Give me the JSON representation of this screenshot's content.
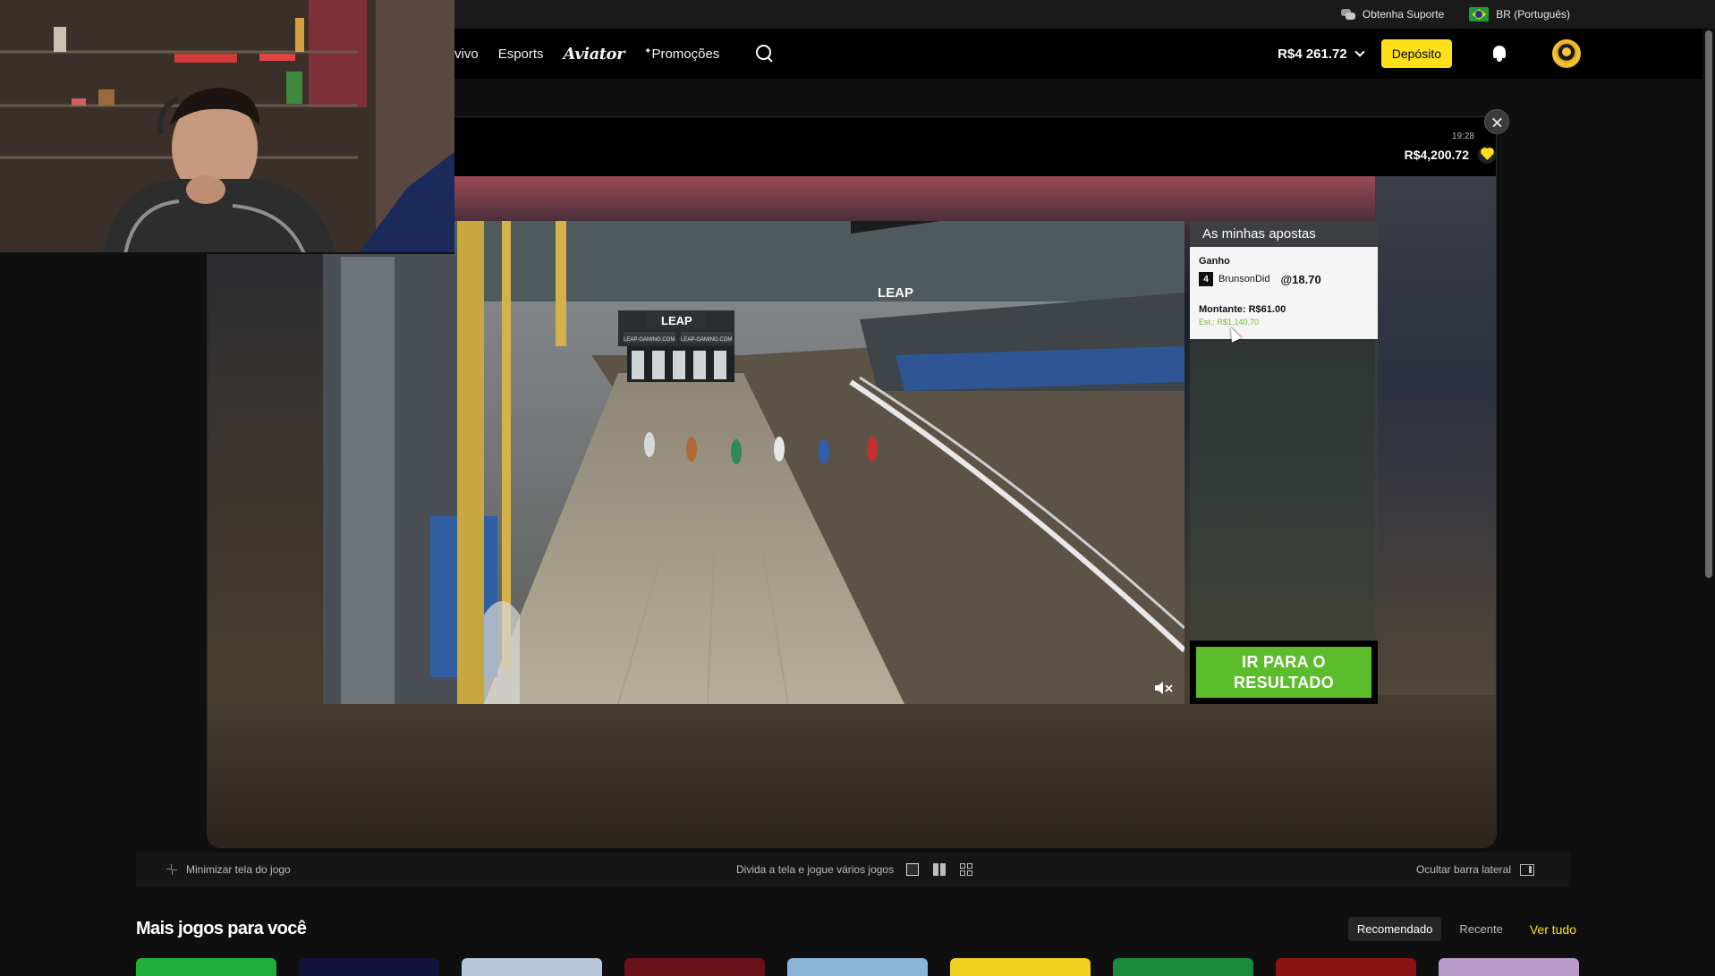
{
  "topbar": {
    "support_label": "Obtenha Suporte",
    "language_label": "BR (Português)"
  },
  "nav": {
    "items": [
      "vivo",
      "Esports",
      "Aviator",
      "Promoções"
    ],
    "balance": "R$4 261.72",
    "deposit_label": "Depósito"
  },
  "game": {
    "clock": "19:28",
    "balance": "R$4,200.72",
    "bets_panel": {
      "title": "As minhas apostas",
      "bet_type": "Ganho",
      "trap_number": "4",
      "selection": "BrunsonDid",
      "odds": "@18.70",
      "stake": "Montante: R$61.00",
      "estimate": "Est.: R$1,140.70"
    },
    "result_button": "IR PARA O RESULTADO",
    "video_signage": [
      "LEAP",
      "LEAP",
      "LEAP-GAMING.COM",
      "LEAP-GAMING.COM"
    ]
  },
  "controls": {
    "minimize_label": "Minimizar tela do jogo",
    "split_label": "Divida a tela e jogue vários jogos",
    "hide_sidebar_label": "Ocultar barra lateral"
  },
  "more_games": {
    "title": "Mais jogos para você",
    "tabs": [
      "Recomendado",
      "Recente"
    ],
    "active_tab": "Recomendado",
    "see_all": "Ver tudo",
    "tile_colors": [
      "#1fae3a",
      "#12123a",
      "#b8c8d8",
      "#6a1018",
      "#8ab4d6",
      "#f0d020",
      "#1c8a3a",
      "#8a1212",
      "#b89ac8"
    ]
  },
  "colors": {
    "accent_yellow": "#ffe01b",
    "result_green": "#5bbd2c",
    "aviator_red": "#d3182b"
  }
}
